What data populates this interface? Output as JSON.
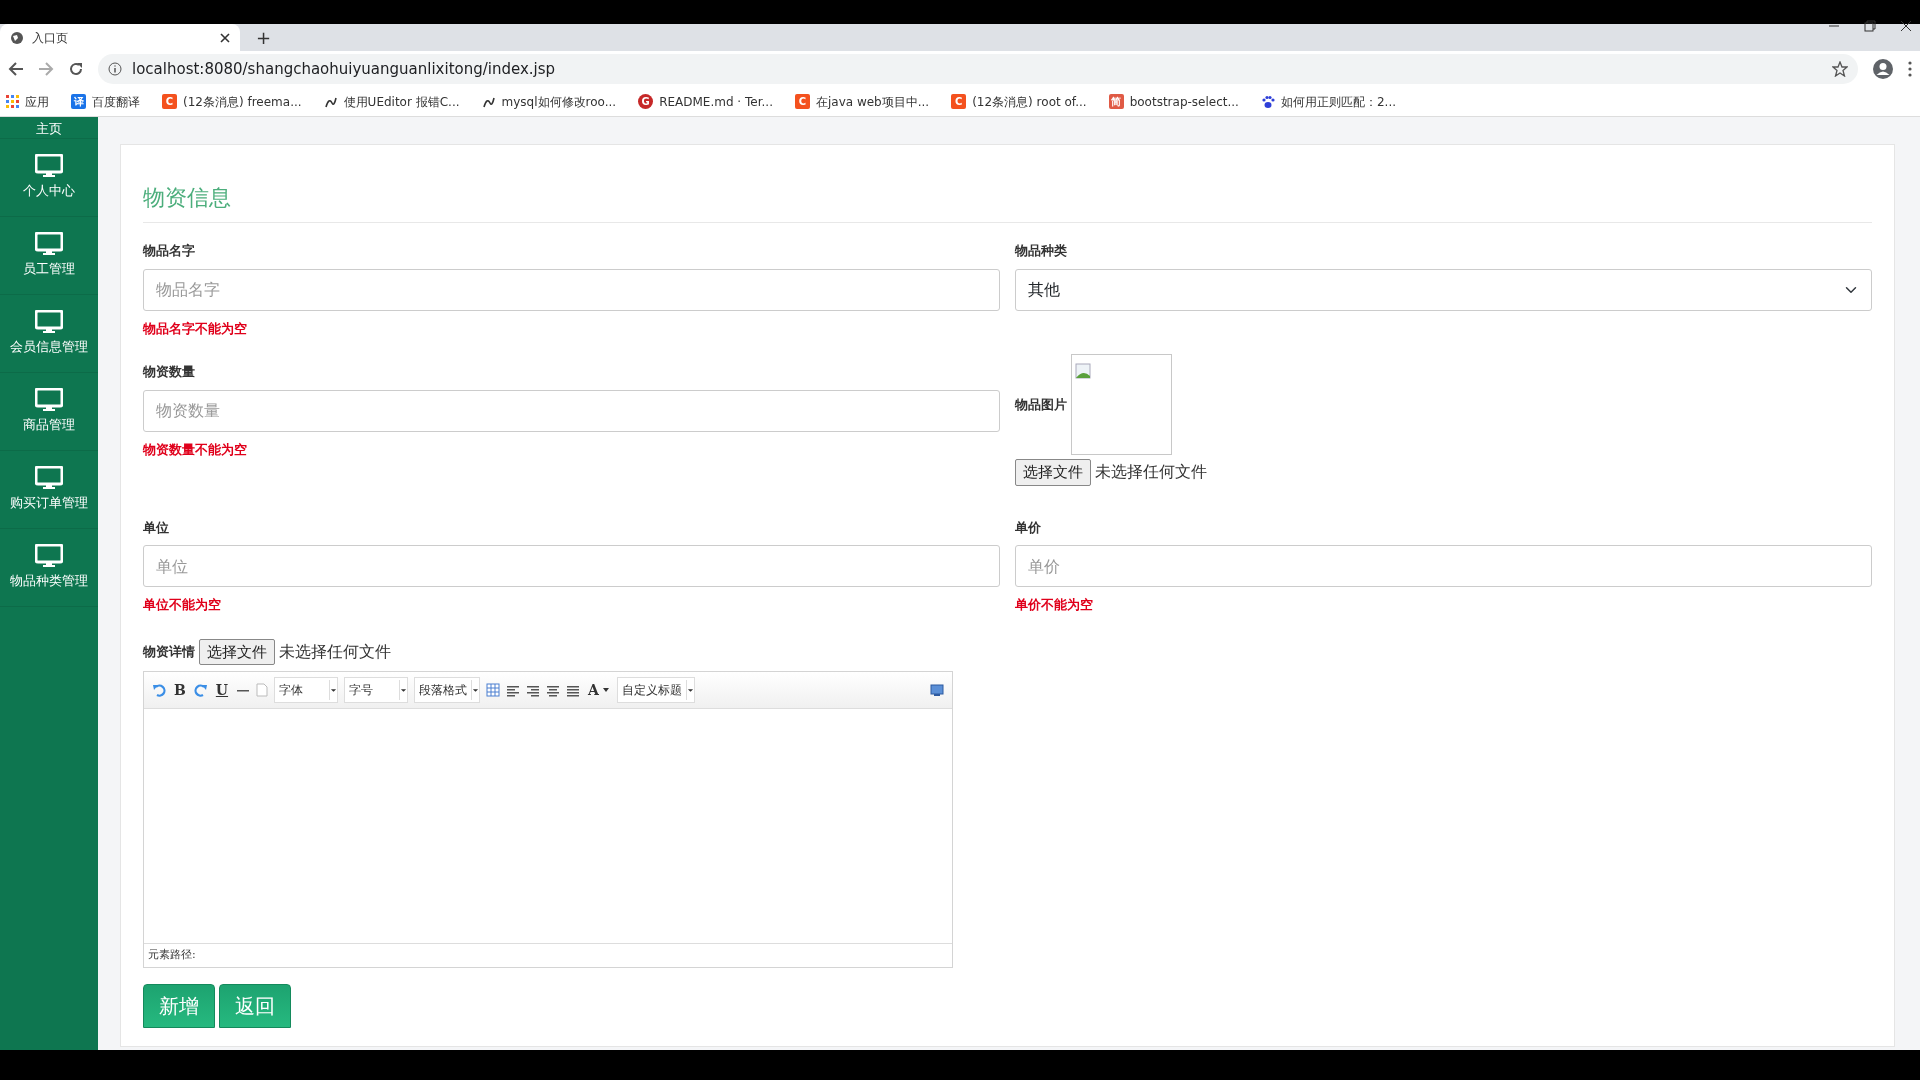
{
  "browser": {
    "tab_title": "入口页",
    "new_tab": "+",
    "url": "localhost:8080/shangchaohuiyuanguanlixitong/index.jsp",
    "bookmarks": [
      {
        "kind": "apps",
        "label": "应用"
      },
      {
        "kind": "square",
        "badge": "译",
        "color": "#1a73e8",
        "label": "百度翻译"
      },
      {
        "kind": "square",
        "badge": "C",
        "color": "#f4511e",
        "label": "(12条消息) freema..."
      },
      {
        "kind": "script",
        "label": "使用UEditor 报错C..."
      },
      {
        "kind": "script",
        "label": "mysql如何修改roo..."
      },
      {
        "kind": "circle",
        "badge": "G",
        "color": "#c62828",
        "label": "README.md · Ter..."
      },
      {
        "kind": "square",
        "badge": "C",
        "color": "#f4511e",
        "label": "在java web项目中..."
      },
      {
        "kind": "square",
        "badge": "C",
        "color": "#f4511e",
        "label": "(12条消息) root of..."
      },
      {
        "kind": "square",
        "badge": "简",
        "color": "#e05a45",
        "label": "bootstrap-select..."
      },
      {
        "kind": "paw",
        "label": "如何用正则匹配：2..."
      }
    ]
  },
  "sidebar": {
    "items": [
      {
        "label": "主页",
        "cut": true
      },
      {
        "label": "个人中心",
        "cut": false
      },
      {
        "label": "员工管理",
        "cut": false
      },
      {
        "label": "会员信息管理",
        "cut": false
      },
      {
        "label": "商品管理",
        "cut": false
      },
      {
        "label": "购买订单管理",
        "cut": false
      },
      {
        "label": "物品种类管理",
        "cut": false
      }
    ]
  },
  "form": {
    "title": "物资信息",
    "fields": [
      {
        "kind": "text",
        "label": "物品名字",
        "placeholder": "物品名字",
        "error": "物品名字不能为空"
      },
      {
        "kind": "select",
        "label": "物品种类",
        "value": "其他"
      },
      {
        "kind": "text",
        "label": "物资数量",
        "placeholder": "物资数量",
        "error": "物资数量不能为空"
      },
      {
        "kind": "image",
        "label": "物品图片",
        "button": "选择文件",
        "file_status": "未选择任何文件"
      },
      {
        "kind": "text",
        "label": "单位",
        "placeholder": "单位",
        "error": "单位不能为空"
      },
      {
        "kind": "text",
        "label": "单价",
        "placeholder": "单价",
        "error": "单价不能为空"
      }
    ],
    "detail": {
      "label": "物资详情",
      "button": "选择文件",
      "file_status": "未选择任何文件",
      "toolbar": [
        {
          "kind": "undo"
        },
        {
          "kind": "letter",
          "text": "B"
        },
        {
          "kind": "redo"
        },
        {
          "kind": "letter",
          "text": "U"
        },
        {
          "kind": "hr"
        },
        {
          "kind": "page"
        },
        {
          "kind": "dropdown",
          "text": "字体"
        },
        {
          "kind": "dropdown",
          "text": "字号"
        },
        {
          "kind": "dropdown",
          "text": "段落格式"
        },
        {
          "kind": "table"
        },
        {
          "kind": "align-left"
        },
        {
          "kind": "align-right"
        },
        {
          "kind": "align-center"
        },
        {
          "kind": "justify"
        },
        {
          "kind": "letter-menu",
          "text": "A"
        },
        {
          "kind": "dropdown",
          "text": "自定义标题"
        },
        {
          "kind": "preview"
        }
      ],
      "path_label": "元素路径:"
    },
    "buttons": [
      {
        "label": "新增"
      },
      {
        "label": "返回"
      }
    ]
  }
}
